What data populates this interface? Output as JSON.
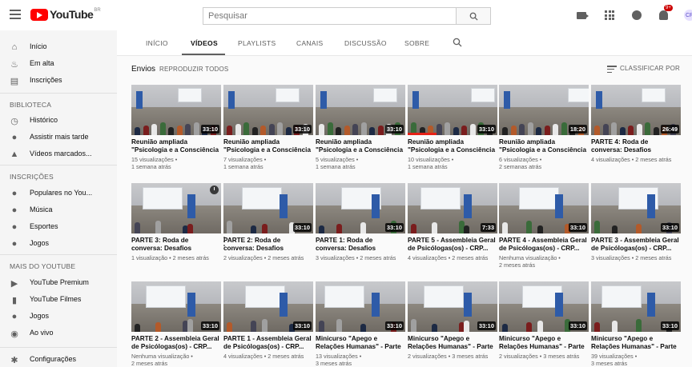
{
  "header": {
    "logo_text": "YouTube",
    "logo_region": "BR",
    "search_placeholder": "Pesquisar",
    "notification_count": "9+",
    "avatar_initials": "CR"
  },
  "sidebar": {
    "main": [
      {
        "label": "Início",
        "icon": "home-icon"
      },
      {
        "label": "Em alta",
        "icon": "trending-icon"
      },
      {
        "label": "Inscrições",
        "icon": "subscriptions-icon"
      }
    ],
    "library_heading": "BIBLIOTECA",
    "library": [
      {
        "label": "Histórico",
        "icon": "history-icon"
      },
      {
        "label": "Assistir mais tarde",
        "icon": "watch-later-icon"
      },
      {
        "label": "Vídeos marcados...",
        "icon": "liked-icon"
      }
    ],
    "subs_heading": "INSCRIÇÕES",
    "subs": [
      {
        "label": "Populares no You...",
        "icon": "popular-icon"
      },
      {
        "label": "Música",
        "icon": "music-icon"
      },
      {
        "label": "Esportes",
        "icon": "sports-icon"
      },
      {
        "label": "Jogos",
        "icon": "gaming-icon"
      }
    ],
    "more_heading": "MAIS DO YOUTUBE",
    "more": [
      {
        "label": "YouTube Premium",
        "icon": "premium-icon"
      },
      {
        "label": "YouTube Filmes",
        "icon": "movies-icon"
      },
      {
        "label": "Jogos",
        "icon": "gaming-icon"
      },
      {
        "label": "Ao vivo",
        "icon": "live-icon"
      }
    ],
    "settings": {
      "label": "Configurações",
      "icon": "gear-icon"
    }
  },
  "tabs": [
    "INÍCIO",
    "VÍDEOS",
    "PLAYLISTS",
    "CANAIS",
    "DISCUSSÃO",
    "SOBRE"
  ],
  "active_tab": "VÍDEOS",
  "section": {
    "title": "Envios",
    "play_all": "REPRODUZIR TODOS",
    "sort_by": "CLASSIFICAR POR"
  },
  "videos": [
    {
      "title": "Reunião ampliada \"Psicologia e a Consciência Negra\" -...",
      "views": "15 visualizações •",
      "age": "1 semana atrás",
      "duration": "33:10"
    },
    {
      "title": "Reunião ampliada \"Psicologia e a Consciência Negra\" -...",
      "views": "7 visualizações •",
      "age": "1 semana atrás",
      "duration": "33:10"
    },
    {
      "title": "Reunião ampliada \"Psicologia e a Consciência Negra\" -...",
      "views": "5 visualizações •",
      "age": "1 semana atrás",
      "duration": "33:10"
    },
    {
      "title": "Reunião ampliada \"Psicologia e a Consciência Negra\" -...",
      "views": "10 visualizações •",
      "age": "1 semana atrás",
      "duration": "33:10"
    },
    {
      "title": "Reunião ampliada \"Psicologia e a Consciência Negra\" -...",
      "views": "6 visualizações •",
      "age": "2 semanas atrás",
      "duration": "18:20"
    },
    {
      "title": "PARTE 4: Roda de conversa: Desafios Profissionais da...",
      "views": "4 visualizações • 2 meses atrás",
      "age": "",
      "duration": "26:49"
    },
    {
      "title": "PARTE 3: Roda de conversa: Desafios Profissionais da...",
      "views": "1 visualização • 2 meses atrás",
      "age": "",
      "duration": ""
    },
    {
      "title": "PARTE 2: Roda de conversa: Desafios Profissionais da...",
      "views": "2 visualizações • 2 meses atrás",
      "age": "",
      "duration": "33:10"
    },
    {
      "title": "PARTE 1: Roda de conversa: Desafios Profissionais da...",
      "views": "3 visualizações • 2 meses atrás",
      "age": "",
      "duration": "33:10"
    },
    {
      "title": "PARTE 5 - Assembleia Geral de Psicólogas(os) - CRP...",
      "views": "4 visualizações • 2 meses atrás",
      "age": "",
      "duration": "7:33"
    },
    {
      "title": "PARTE 4 - Assembleia Geral de Psicólogas(os) - CRP...",
      "views": "Nenhuma visualização •",
      "age": "2 meses atrás",
      "duration": "33:10"
    },
    {
      "title": "PARTE 3 - Assembleia Geral de Psicólogas(os) - CRP...",
      "views": "3 visualizações • 2 meses atrás",
      "age": "",
      "duration": "33:10"
    },
    {
      "title": "PARTE 2 - Assembleia Geral de Psicólogas(os) - CRP...",
      "views": "Nenhuma visualização •",
      "age": "2 meses atrás",
      "duration": "33:10"
    },
    {
      "title": "PARTE 1 - Assembleia Geral de Psicólogas(os) - CRP...",
      "views": "4 visualizações • 2 meses atrás",
      "age": "",
      "duration": "33:10"
    },
    {
      "title": "Minicurso \"Apego e Relações Humanas\" - Parte 3",
      "views": "13 visualizações •",
      "age": "3 meses atrás",
      "duration": "33:10"
    },
    {
      "title": "Minicurso \"Apego e Relações Humanas\" - Parte 5",
      "views": "2 visualizações • 3 meses atrás",
      "age": "",
      "duration": "33:10"
    },
    {
      "title": "Minicurso \"Apego e Relações Humanas\" - Parte 2",
      "views": "2 visualizações • 3 meses atrás",
      "age": "",
      "duration": "33:10"
    },
    {
      "title": "Minicurso \"Apego e Relações Humanas\" - Parte 1",
      "views": "39 visualizações •",
      "age": "3 meses atrás",
      "duration": "33:10"
    }
  ]
}
